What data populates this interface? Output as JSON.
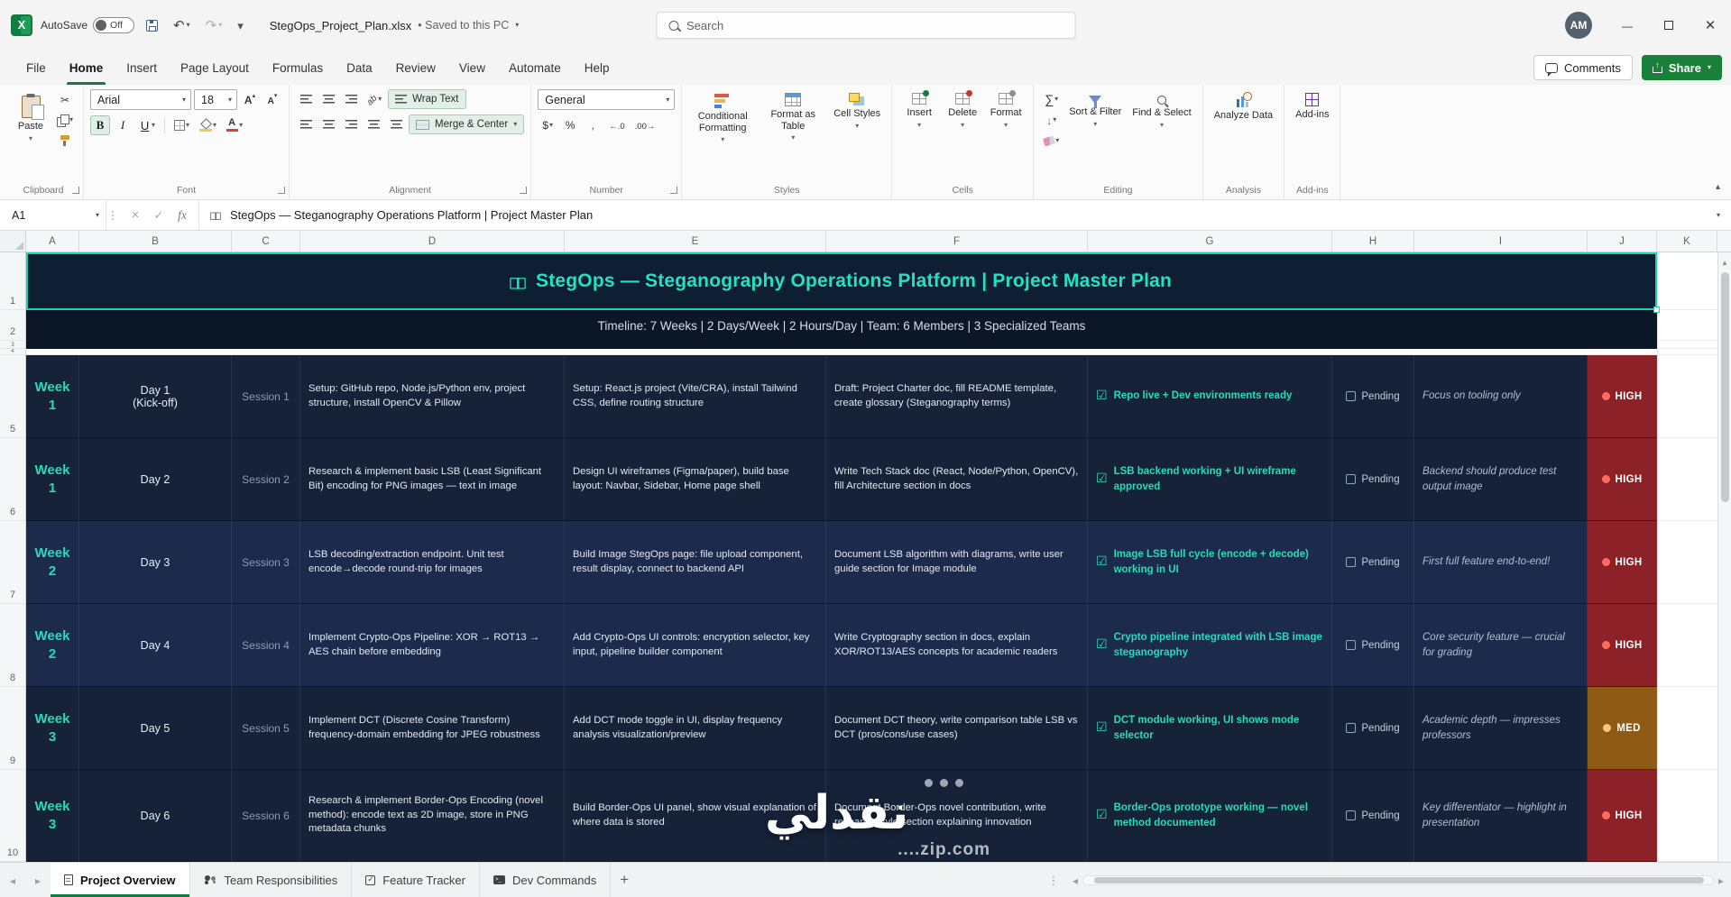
{
  "titlebar": {
    "autosave_label": "AutoSave",
    "autosave_state": "Off",
    "filename": "StegOps_Project_Plan.xlsx",
    "saved_status": "• Saved to this PC",
    "search_placeholder": "Search",
    "avatar_initials": "AM"
  },
  "ribbon": {
    "tabs": [
      {
        "label": "File"
      },
      {
        "label": "Home",
        "state_class": "active"
      },
      {
        "label": "Insert"
      },
      {
        "label": "Page Layout"
      },
      {
        "label": "Formulas"
      },
      {
        "label": "Data"
      },
      {
        "label": "Review"
      },
      {
        "label": "View"
      },
      {
        "label": "Automate"
      },
      {
        "label": "Help"
      }
    ],
    "comments_label": "Comments",
    "share_label": "Share",
    "groups": {
      "clipboard": {
        "label": "Clipboard",
        "paste": "Paste"
      },
      "font": {
        "label": "Font",
        "name": "Arial",
        "size": "18",
        "bold": "B",
        "italic": "I",
        "underline": "U"
      },
      "alignment": {
        "label": "Alignment",
        "wrap_text": "Wrap Text",
        "merge_center": "Merge & Center"
      },
      "number": {
        "label": "Number",
        "format": "General",
        "currency": "$",
        "percent": "%",
        "comma": ","
      },
      "styles": {
        "label": "Styles",
        "conditional": "Conditional Formatting",
        "format_table": "Format as Table",
        "cell_styles": "Cell Styles"
      },
      "cells": {
        "label": "Cells",
        "insert": "Insert",
        "delete": "Delete",
        "format": "Format"
      },
      "editing": {
        "label": "Editing",
        "sort_filter": "Sort & Filter",
        "find_select": "Find & Select"
      },
      "analysis": {
        "label": "Analysis",
        "analyze": "Analyze Data"
      },
      "addins": {
        "label": "Add-ins",
        "addins": "Add-ins"
      }
    }
  },
  "formula_bar": {
    "name_box": "A1",
    "fx_label": "fx",
    "value": "StegOps — Steganography Operations Platform | Project Master Plan"
  },
  "grid": {
    "column_headers": [
      {
        "label": "A",
        "cls": "col-a"
      },
      {
        "label": "B",
        "cls": "col-b"
      },
      {
        "label": "C",
        "cls": "col-c"
      },
      {
        "label": "D",
        "cls": "col-d"
      },
      {
        "label": "E",
        "cls": "col-e"
      },
      {
        "label": "F",
        "cls": "col-f"
      },
      {
        "label": "G",
        "cls": "col-g"
      },
      {
        "label": "H",
        "cls": "col-h"
      },
      {
        "label": "I",
        "cls": "col-i"
      },
      {
        "label": "J",
        "cls": "col-j"
      },
      {
        "label": "K",
        "cls": "col-k"
      }
    ],
    "row_numbers": [
      "1",
      "2",
      "3",
      "4"
    ],
    "title": "StegOps — Steganography Operations Platform  |  Project Master Plan",
    "subtitle": "Timeline: 7 Weeks  |  2 Days/Week  |  2 Hours/Day  |  Team: 6 Members  |  3 Specialized Teams",
    "data_rows": [
      {
        "num": "5",
        "row_class": "shade-a",
        "week": "Week\n1",
        "day": "Day 1\n(Kick-off)",
        "session": "Session 1",
        "task_backend": "Setup: GitHub repo, Node.js/Python env, project structure, install OpenCV & Pillow",
        "task_frontend": "Setup: React.js project (Vite/CRA), install Tailwind CSS, define routing structure",
        "task_docs": "Draft: Project Charter doc, fill README template, create glossary (Steganography terms)",
        "deliverable": "Repo live + Dev environments ready",
        "status": "Pending",
        "note": "Focus on tooling only",
        "priority": "HIGH",
        "prio_class": "prio-high"
      },
      {
        "num": "6",
        "row_class": "shade-a",
        "week": "Week\n1",
        "day": "Day 2",
        "session": "Session 2",
        "task_backend": "Research & implement basic LSB (Least Significant Bit) encoding for PNG images — text in image",
        "task_frontend": "Design UI wireframes (Figma/paper), build base layout: Navbar, Sidebar, Home page shell",
        "task_docs": "Write Tech Stack doc (React, Node/Python, OpenCV), fill Architecture section in docs",
        "deliverable": "LSB backend working + UI wireframe approved",
        "status": "Pending",
        "note": "Backend should produce test output image",
        "priority": "HIGH",
        "prio_class": "prio-high"
      },
      {
        "num": "7",
        "row_class": "shade-b",
        "week": "Week\n2",
        "day": "Day 3",
        "session": "Session 3",
        "task_backend": "LSB decoding/extraction endpoint. Unit test encode→decode round-trip for images",
        "task_frontend": "Build Image StegOps page: file upload component, result display, connect to backend API",
        "task_docs": "Document LSB algorithm with diagrams, write user guide section for Image module",
        "deliverable": "Image LSB full cycle (encode + decode) working in UI",
        "status": "Pending",
        "note": "First full feature end-to-end!",
        "priority": "HIGH",
        "prio_class": "prio-high"
      },
      {
        "num": "8",
        "row_class": "shade-b",
        "week": "Week\n2",
        "day": "Day 4",
        "session": "Session 4",
        "task_backend": "Implement Crypto-Ops Pipeline: XOR → ROT13 → AES chain before embedding",
        "task_frontend": "Add Crypto-Ops UI controls: encryption selector, key input, pipeline builder component",
        "task_docs": "Write Cryptography section in docs, explain XOR/ROT13/AES concepts for academic readers",
        "deliverable": "Crypto pipeline integrated with LSB image steganography",
        "status": "Pending",
        "note": "Core security feature — crucial for grading",
        "priority": "HIGH",
        "prio_class": "prio-high"
      },
      {
        "num": "9",
        "row_class": "shade-a",
        "week": "Week\n3",
        "day": "Day 5",
        "session": "Session 5",
        "task_backend": "Implement DCT (Discrete Cosine Transform) frequency-domain embedding for JPEG robustness",
        "task_frontend": "Add DCT mode toggle in UI, display frequency analysis visualization/preview",
        "task_docs": "Document DCT theory, write comparison table LSB vs DCT (pros/cons/use cases)",
        "deliverable": "DCT module working, UI shows mode selector",
        "status": "Pending",
        "note": "Academic depth — impresses professors",
        "priority": "MED",
        "prio_class": "prio-med"
      },
      {
        "num": "10",
        "row_class": "shade-a",
        "week": "Week\n3",
        "day": "Day 6",
        "session": "Session 6",
        "task_backend": "Research & implement Border-Ops Encoding (novel method): encode text as 2D image, store in PNG metadata chunks",
        "task_frontend": "Build Border-Ops UI panel, show visual explanation of where data is stored",
        "task_docs": "Document Border-Ops novel contribution, write research-style section explaining innovation",
        "deliverable": "Border-Ops prototype working — novel method documented",
        "status": "Pending",
        "note": "Key differentiator — highlight in presentation",
        "priority": "HIGH",
        "prio_class": "prio-high"
      }
    ]
  },
  "sheet_bar": {
    "tabs": [
      {
        "label": "Project Overview",
        "state_class": "active",
        "icon": "ic-doc"
      },
      {
        "label": "Team Responsibilities",
        "icon": "ic-people"
      },
      {
        "label": "Feature Tracker",
        "icon": "ic-check"
      },
      {
        "label": "Dev Commands",
        "icon": "ic-terminal"
      }
    ],
    "add_label": "+"
  },
  "watermark": {
    "text": "نقدلي",
    "domain": "....zip.com"
  },
  "icons": {
    "banner_cell": "gift-icon",
    "deliverable_cell": "checkbox-checked-icon",
    "status_cell": "checkbox-empty-icon",
    "priority_cell": "dot-icon"
  },
  "colors": {
    "accent_green": "#107C41",
    "table_teal": "#25e0c2",
    "banner_bg": "#0E1E33",
    "row_shade_a": "#152238",
    "row_shade_b": "#1C2B4B",
    "priority_high_bg": "#8C2127",
    "priority_med_bg": "#8F5A14"
  }
}
